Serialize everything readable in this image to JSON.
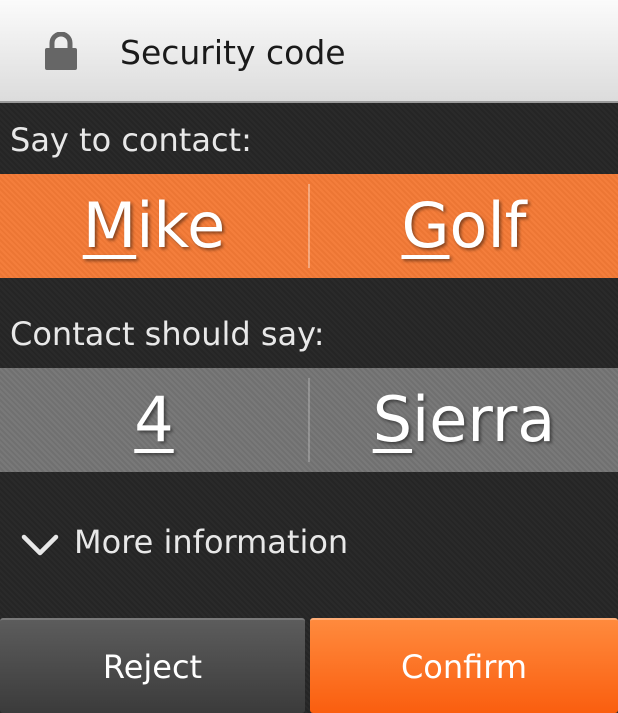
{
  "header": {
    "icon": "lock-icon",
    "title": "Security code"
  },
  "say_to_contact": {
    "label": "Say to contact:",
    "words": [
      {
        "first": "M",
        "rest": "ike"
      },
      {
        "first": "G",
        "rest": "olf"
      }
    ]
  },
  "contact_should_say": {
    "label": "Contact should say:",
    "words": [
      {
        "first": "4",
        "rest": ""
      },
      {
        "first": "S",
        "rest": "ierra"
      }
    ]
  },
  "more_info": {
    "icon": "chevron-down-icon",
    "label": "More information"
  },
  "buttons": {
    "reject_label": "Reject",
    "confirm_label": "Confirm"
  },
  "colors": {
    "accent_orange": "#f47a36",
    "confirm_orange": "#fa5e0f",
    "band_gray": "#747474",
    "background": "#262626"
  }
}
